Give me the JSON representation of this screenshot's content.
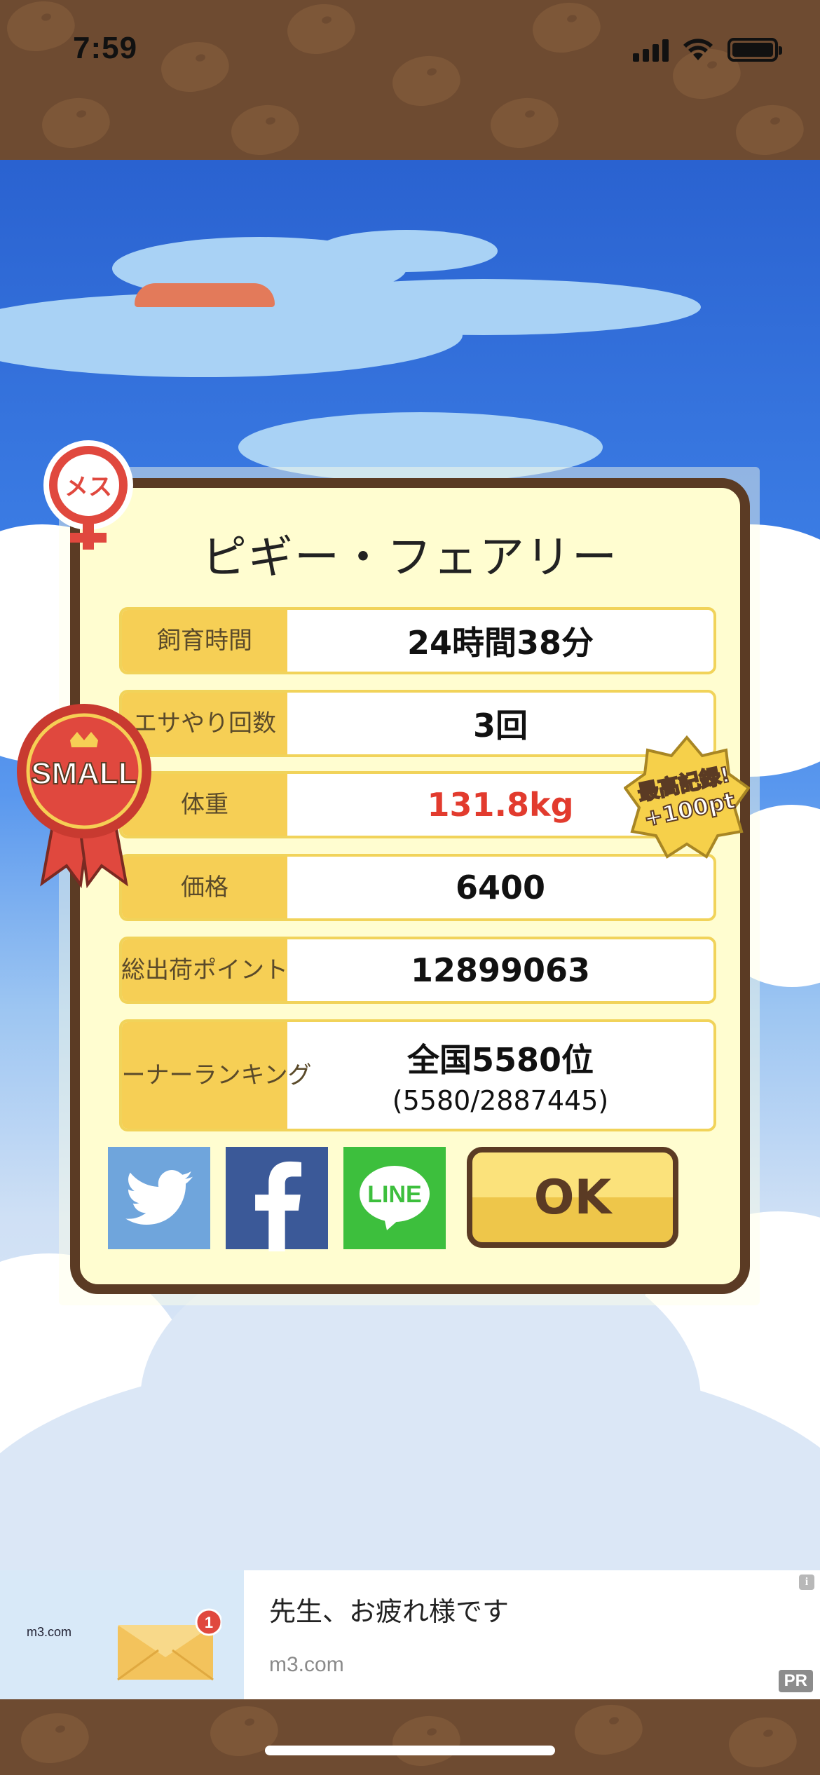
{
  "status_bar": {
    "time": "7:59"
  },
  "dialog": {
    "title": "ピギー・フェアリー",
    "rows": [
      {
        "label": "飼育時間",
        "value": "24時間38分"
      },
      {
        "label": "エサやり回数",
        "value": "3回"
      },
      {
        "label": "体重",
        "value": "131.8kg",
        "highlight": "#e23b2e"
      },
      {
        "label": "価格",
        "value": "6400"
      },
      {
        "label_line1": "総出荷",
        "label_line2": "ポイント",
        "value": "12899063"
      },
      {
        "label_line1": "オーナー",
        "label_line2": "ランキング",
        "value": "全国5580位",
        "sub": "(5580/2887445)"
      }
    ],
    "ok_label": "OK"
  },
  "badges": {
    "gender": "メス",
    "size": "SMALL",
    "record_line1": "最高記録!",
    "record_line2": "+100pt"
  },
  "share": {
    "twitter_icon": "twitter-bird-icon",
    "facebook_icon": "facebook-f-icon",
    "line_label": "LINE",
    "colors": {
      "twitter": "#6fa5dc",
      "facebook": "#3b5998",
      "line": "#3dbf3d"
    }
  },
  "ad": {
    "brand": "m3.com",
    "title": "先生、お疲れ様です",
    "domain": "m3.com",
    "pr": "PR",
    "badge_count": "1",
    "info": "i"
  }
}
